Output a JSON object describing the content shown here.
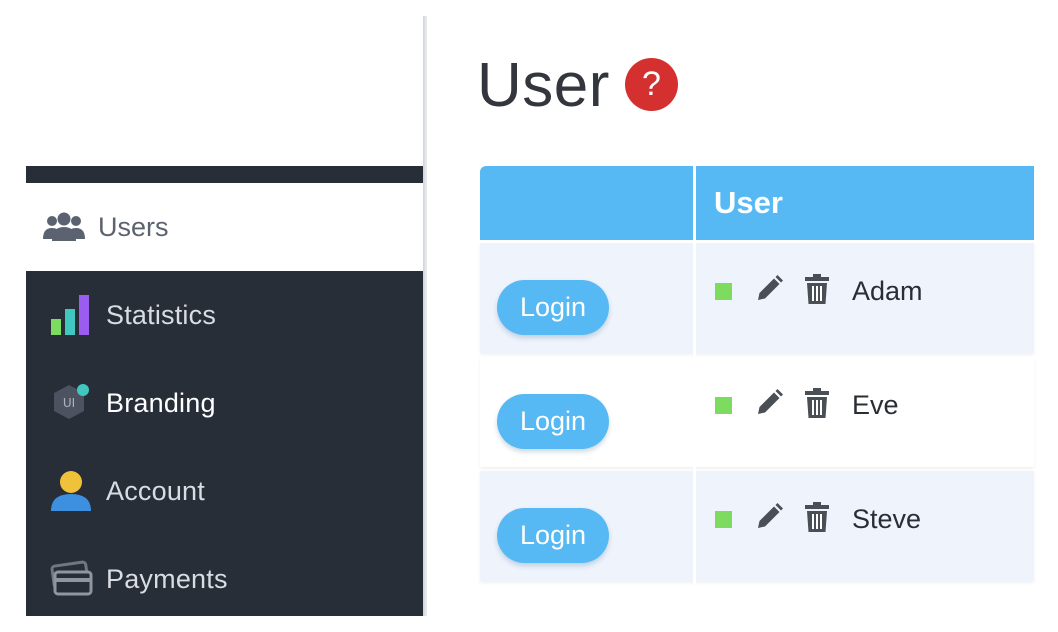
{
  "sidebar": {
    "items": [
      {
        "label": "Users",
        "icon": "users-icon"
      },
      {
        "label": "Statistics",
        "icon": "bar-chart-icon"
      },
      {
        "label": "Branding",
        "icon": "ui-hexagon-icon"
      },
      {
        "label": "Account",
        "icon": "person-icon"
      },
      {
        "label": "Payments",
        "icon": "credit-card-icon"
      }
    ]
  },
  "page": {
    "title": "User",
    "help_symbol": "?"
  },
  "table": {
    "columns": [
      "",
      "User"
    ],
    "rows": [
      {
        "action_label": "Login",
        "name": "Adam"
      },
      {
        "action_label": "Login",
        "name": "Eve"
      },
      {
        "action_label": "Login",
        "name": "Steve"
      }
    ]
  },
  "colors": {
    "sidebar_bg": "#282e38",
    "accent_blue": "#56b9f4",
    "help_red": "#d3302f",
    "status_green": "#7ddc5f"
  }
}
